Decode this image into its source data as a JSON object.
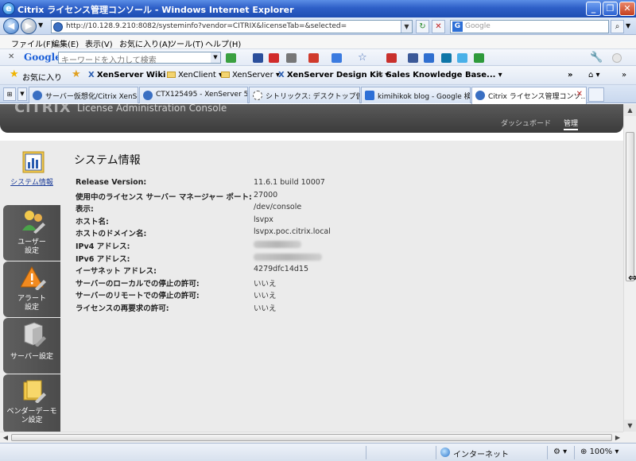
{
  "window": {
    "title": "Citrix ライセンス管理コンソール - Windows Internet Explorer",
    "controls": [
      "_",
      "❐",
      "✕"
    ]
  },
  "address_bar": {
    "url": "http://10.128.9.210:8082/systeminfo?vendor=CITRIX&licenseTab=&selected=",
    "search_placeholder": "Google"
  },
  "menu": [
    "ファイル(F)",
    "編集(E)",
    "表示(V)",
    "お気に入り(A)",
    "ツール(T)",
    "ヘルプ(H)"
  ],
  "google_toolbar": {
    "label": "Google",
    "search_placeholder": "キーワードを入力して検索"
  },
  "favorites_bar": {
    "favorites_label": "お気に入り",
    "items": [
      "XenServer Wiki",
      "XenClient",
      "XenServer",
      "XenServer Design Kit",
      "Sales Knowledge Base..."
    ]
  },
  "tabs": [
    "サーバー仮想化/Citrix XenSe...",
    "CTX125495 - XenServer 5.6...",
    "シトリックス: デスクトップ仮想...",
    "kimihikok blog - Google 検索",
    "Citrix ライセンス管理コンソ..."
  ],
  "banner": {
    "brand": "CiTRiX",
    "app_name": "License Administration Console",
    "nav": [
      "ダッシュボード",
      "管理"
    ]
  },
  "sidebar": [
    {
      "label": "システム情報",
      "active": true,
      "icon": "system-info-icon"
    },
    {
      "label": "ユーザー設定",
      "active": false,
      "icon": "user-settings-icon"
    },
    {
      "label": "アラート設定",
      "active": false,
      "icon": "alert-settings-icon"
    },
    {
      "label": "サーバー設定",
      "active": false,
      "icon": "server-settings-icon"
    },
    {
      "label": "ベンダーデーモン設定",
      "active": false,
      "icon": "vendor-daemon-icon"
    }
  ],
  "system_info": {
    "title": "システム情報",
    "rows": [
      {
        "label": "Release Version:",
        "value": "11.6.1 build 10007"
      },
      {
        "label": "使用中のライセンス サーバー マネージャー ポート:",
        "value": "27000"
      },
      {
        "label": "表示:",
        "value": "/dev/console"
      },
      {
        "label": "ホスト名:",
        "value": "lsvpx"
      },
      {
        "label": "ホストのドメイン名:",
        "value": "lsvpx.poc.citrix.local"
      },
      {
        "label": "IPv4 アドレス:",
        "value": ""
      },
      {
        "label": "IPv6 アドレス:",
        "value": ""
      },
      {
        "label": "イーサネット アドレス:",
        "value": "4279dfc14d15"
      },
      {
        "label": "サーバーのローカルでの停止の許可:",
        "value": "いいえ"
      },
      {
        "label": "サーバーのリモートでの停止の許可:",
        "value": "いいえ"
      },
      {
        "label": "ライセンスの再要求の許可:",
        "value": "いいえ"
      }
    ]
  },
  "status_bar": {
    "zone": "インターネット",
    "zoom": "100%"
  }
}
